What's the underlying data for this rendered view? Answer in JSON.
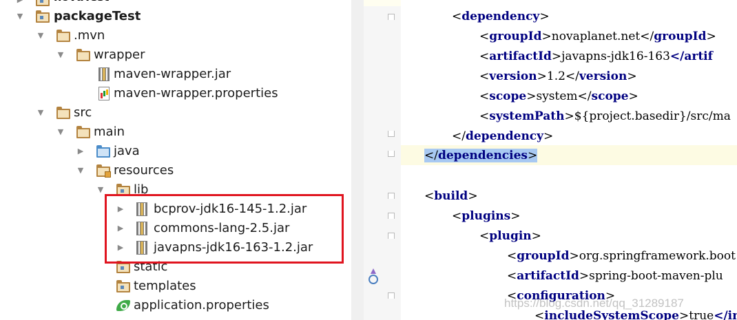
{
  "tree": {
    "cut_label": "novaTest",
    "items": [
      {
        "label": "packageTest"
      },
      {
        "label": ".mvn"
      },
      {
        "label": "wrapper"
      },
      {
        "label": "maven-wrapper.jar"
      },
      {
        "label": "maven-wrapper.properties"
      },
      {
        "label": "src"
      },
      {
        "label": "main"
      },
      {
        "label": "java"
      },
      {
        "label": "resources"
      },
      {
        "label": "lib"
      },
      {
        "label": "bcprov-jdk16-145-1.2.jar"
      },
      {
        "label": "commons-lang-2.5.jar"
      },
      {
        "label": "javapns-jdk16-163-1.2.jar"
      },
      {
        "label": "static"
      },
      {
        "label": "templates"
      },
      {
        "label": "application.properties"
      }
    ]
  },
  "editor": {
    "lines": [
      {
        "tag": "dependency",
        "kind": "open"
      },
      {
        "tag": "groupId",
        "text": "novaplanet.net"
      },
      {
        "tag": "artifactId",
        "text": "javapns-jdk16-163",
        "close_tail": "</artif"
      },
      {
        "tag": "version",
        "text": "1.2"
      },
      {
        "tag": "scope",
        "text": "system"
      },
      {
        "tag": "systemPath",
        "text": "${project.basedir}/src/ma"
      },
      {
        "tag": "dependency",
        "kind": "close"
      },
      {
        "tag": "dependencies",
        "kind": "close"
      },
      {
        "tag": "build",
        "kind": "open"
      },
      {
        "tag": "plugins",
        "kind": "open"
      },
      {
        "tag": "plugin",
        "kind": "open"
      },
      {
        "tag": "groupId",
        "text": "org.springframework.boot"
      },
      {
        "tag": "artifactId",
        "text": "spring-boot-maven-plu"
      },
      {
        "tag": "configuration",
        "kind": "open"
      },
      {
        "tag": "includeSystemScope",
        "text": "true",
        "close_tail": "</in"
      }
    ]
  },
  "watermark": "https://blog.csdn.net/qq_31289187",
  "colors": {
    "tag": "#000080",
    "highlight_box": "#e0141f",
    "selection": "#a8c9f2",
    "caret_line": "#fdfbe3"
  }
}
